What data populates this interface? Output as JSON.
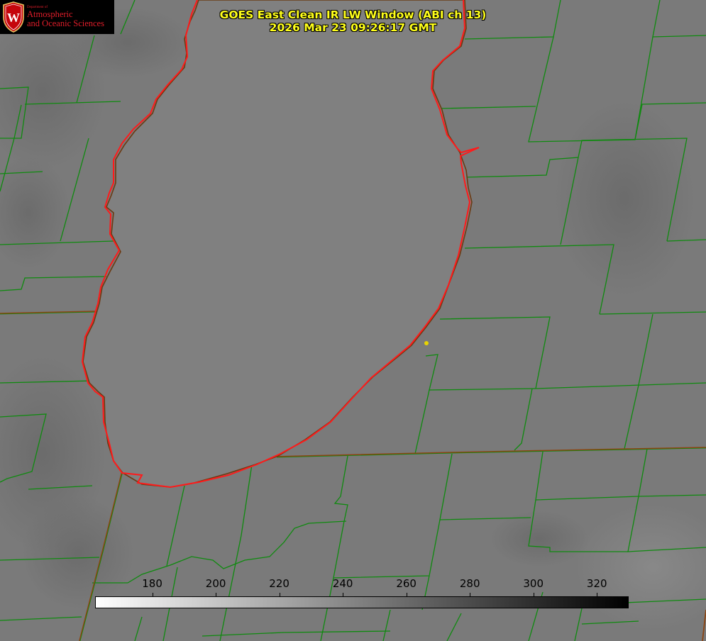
{
  "title": {
    "line1": "GOES East Clean IR LW Window (ABI ch 13)",
    "line2": "2026 Mar 23 09:26:17 GMT"
  },
  "logo": {
    "department": "Department of",
    "line1": "Atmospheric",
    "line2": "and Oceanic Sciences",
    "crest_letter": "W"
  },
  "colorbar": {
    "min": 162,
    "max": 330,
    "ticks": [
      "180",
      "200",
      "220",
      "240",
      "260",
      "280",
      "300",
      "320"
    ],
    "tick_values": [
      180,
      200,
      220,
      240,
      260,
      280,
      300,
      320
    ],
    "start_color": "#ffffff",
    "end_color": "#000000"
  },
  "colors": {
    "background": "#7a7a7a",
    "lake": "#808080",
    "county_lines": "#0f8a0f",
    "state_lines": "#8b4513",
    "shoreline_hires": "#ff1a1a",
    "title_text": "#ffff1a",
    "marker": "#e8d400"
  }
}
